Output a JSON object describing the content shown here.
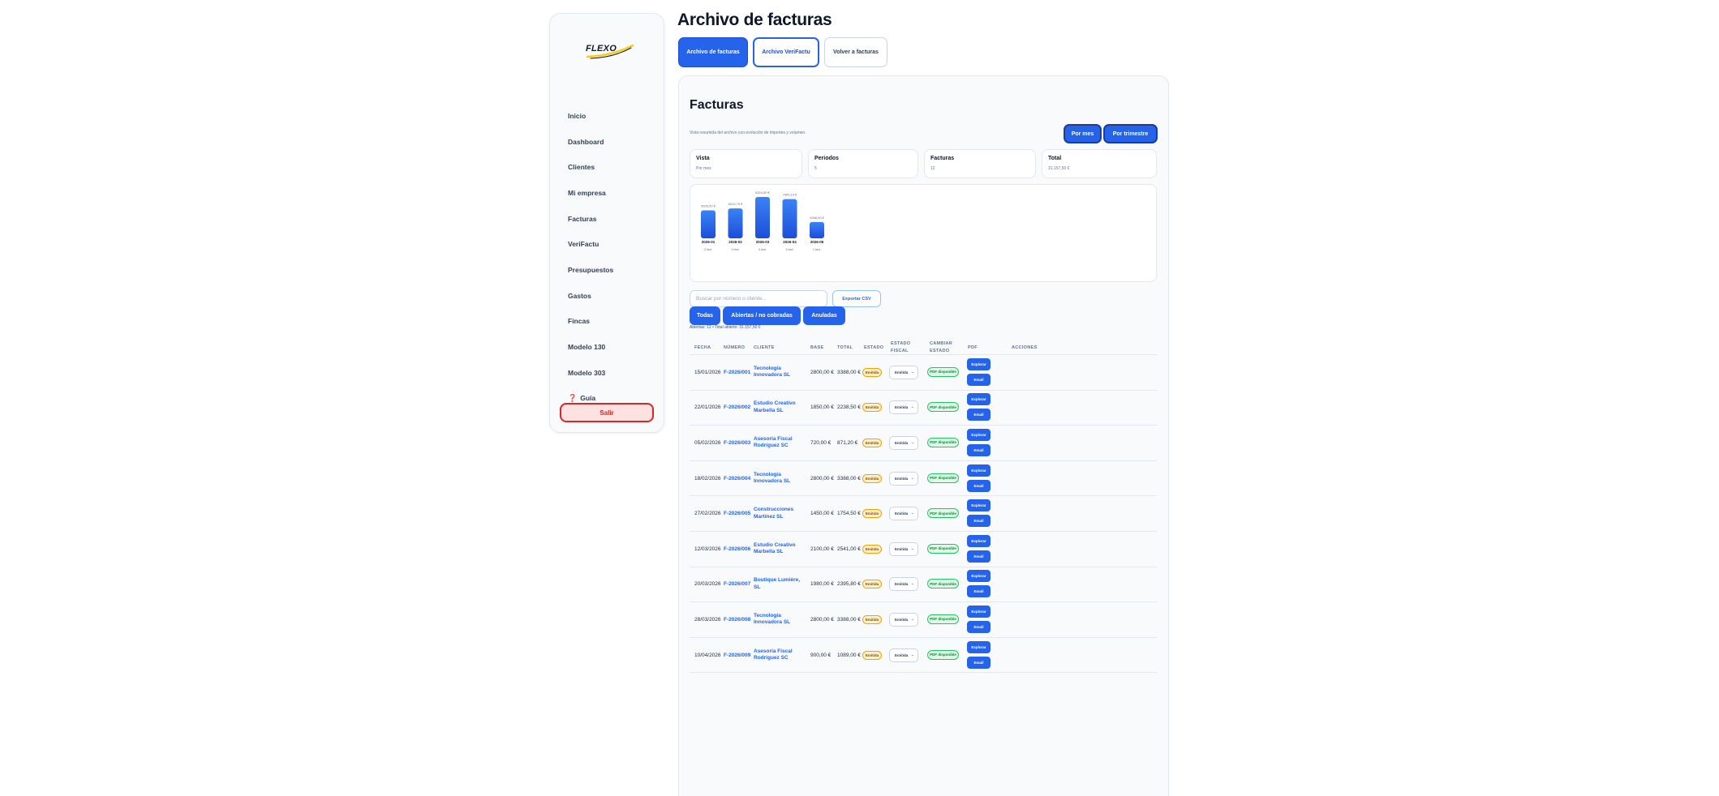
{
  "sidebar": {
    "logo_text": "FLEXO",
    "items": [
      {
        "label": "Inicio"
      },
      {
        "label": "Dashboard"
      },
      {
        "label": "Clientes"
      },
      {
        "label": "Mi empresa"
      },
      {
        "label": "Facturas"
      },
      {
        "label": "VeriFactu"
      },
      {
        "label": "Presupuestos"
      },
      {
        "label": "Gastos"
      },
      {
        "label": "Fincas"
      },
      {
        "label": "Modelo 130"
      },
      {
        "label": "Modelo 303"
      },
      {
        "label": "Guía",
        "icon": "question-icon",
        "glyph": "❓"
      }
    ],
    "logout_label": "Salir"
  },
  "header": {
    "title": "Archivo de facturas",
    "tabs": [
      {
        "label": "Archivo de facturas"
      },
      {
        "label": "Archivo VeriFactu"
      },
      {
        "label": "Volver a facturas"
      }
    ]
  },
  "main": {
    "title": "Facturas",
    "subtitle": "Vista resumida del archivo con evolución de importes y volumen.",
    "period_buttons": {
      "month": "Por mes",
      "quarter": "Por trimestre"
    },
    "stats": [
      {
        "label": "Vista",
        "value": "Por mes"
      },
      {
        "label": "Periodos",
        "value": "5"
      },
      {
        "label": "Facturas",
        "value": "12"
      },
      {
        "label": "Total",
        "value": "31.157,50 €"
      }
    ],
    "search_placeholder": "Buscar por número o cliente...",
    "export_label": "Exportar CSV",
    "filters": {
      "all": "Todas",
      "open": "Abiertas / no cobradas",
      "cancelled": "Anuladas"
    },
    "summary": "Abiertas: 12 • Total abierto: 31.157,50 €",
    "table": {
      "headers": {
        "fecha": "FECHA",
        "numero": "NÚMERO",
        "cliente": "CLIENTE",
        "base": "BASE",
        "total": "TOTAL",
        "estado": "ESTADO",
        "estado_fiscal_1": "ESTADO",
        "estado_fiscal_2": "FISCAL",
        "cambiar_1": "CAMBIAR",
        "cambiar_2": "ESTADO",
        "pdf": "PDF",
        "acciones": "ACCIONES"
      },
      "rows": [
        {
          "fecha": "15/01/2026",
          "numero": "F-2026/001",
          "cliente": "Tecnología Innovadora SL",
          "base": "2800,00 €",
          "total": "3388,00 €",
          "estado": "Emitida",
          "estado_select": "Emitida",
          "pdf": "PDF disponible",
          "btn_download": "Explorar",
          "btn_email": "Email"
        },
        {
          "fecha": "22/01/2026",
          "numero": "F-2026/002",
          "cliente": "Estudio Creativo Marbella SL",
          "base": "1850,00 €",
          "total": "2238,50 €",
          "estado": "Emitida",
          "estado_select": "Emitida",
          "pdf": "PDF disponible",
          "btn_download": "Explorar",
          "btn_email": "Email"
        },
        {
          "fecha": "05/02/2026",
          "numero": "F-2026/003",
          "cliente": "Asesoría Fiscal Rodríguez SC",
          "base": "720,00 €",
          "total": "871,20 €",
          "estado": "Emitida",
          "estado_select": "Emitida",
          "pdf": "PDF disponible",
          "btn_download": "Explorar",
          "btn_email": "Email"
        },
        {
          "fecha": "18/02/2026",
          "numero": "F-2026/004",
          "cliente": "Tecnología Innovadora SL",
          "base": "2800,00 €",
          "total": "3388,00 €",
          "estado": "Emitida",
          "estado_select": "Emitida",
          "pdf": "PDF disponible",
          "btn_download": "Explorar",
          "btn_email": "Email"
        },
        {
          "fecha": "27/02/2026",
          "numero": "F-2026/005",
          "cliente": "Construcciones Martínez SL",
          "base": "1450,00 €",
          "total": "1754,50 €",
          "estado": "Emitida",
          "estado_select": "Emitida",
          "pdf": "PDF disponible",
          "btn_download": "Explorar",
          "btn_email": "Email"
        },
        {
          "fecha": "12/03/2026",
          "numero": "F-2026/006",
          "cliente": "Estudio Creativo Marbella SL",
          "base": "2100,00 €",
          "total": "2541,00 €",
          "estado": "Emitida",
          "estado_select": "Emitida",
          "pdf": "PDF disponible",
          "btn_download": "Explorar",
          "btn_email": "Email"
        },
        {
          "fecha": "20/03/2026",
          "numero": "F-2026/007",
          "cliente": "Boutique Lumière, SL",
          "base": "1980,00 €",
          "total": "2395,80 €",
          "estado": "Emitida",
          "estado_select": "Emitida",
          "pdf": "PDF disponible",
          "btn_download": "Explorar",
          "btn_email": "Email"
        },
        {
          "fecha": "28/03/2026",
          "numero": "F-2026/008",
          "cliente": "Tecnología Innovadora SL",
          "base": "2800,00 €",
          "total": "3388,00 €",
          "estado": "Emitida",
          "estado_select": "Emitida",
          "pdf": "PDF disponible",
          "btn_download": "Explorar",
          "btn_email": "Email"
        },
        {
          "fecha": "10/04/2026",
          "numero": "F-2026/009",
          "cliente": "Asesoría Fiscal Rodríguez SC",
          "base": "900,00 €",
          "total": "1089,00 €",
          "estado": "Emitida",
          "estado_select": "Emitida",
          "pdf": "PDF disponible",
          "btn_download": "Explorar",
          "btn_email": "Email"
        }
      ]
    }
  },
  "chart_data": {
    "type": "bar",
    "categories": [
      "2026-01",
      "2026-02",
      "2026-03",
      "2026-04",
      "2026-05"
    ],
    "values": [
      5626.5,
      6013.7,
      8324.8,
      7905.1,
      3288.0
    ],
    "value_labels": [
      "5626,50 €",
      "6013,70 €",
      "8324,80 €",
      "7905,10 €",
      "3288,00 €"
    ],
    "counts": [
      "2 fact.",
      "3 fact.",
      "3 fact.",
      "3 fact.",
      "1 fact."
    ],
    "ylim": [
      0,
      8324.8
    ],
    "colors": {
      "bar_top": "#3b82f6",
      "bar_bottom": "#1d4ed8"
    }
  }
}
